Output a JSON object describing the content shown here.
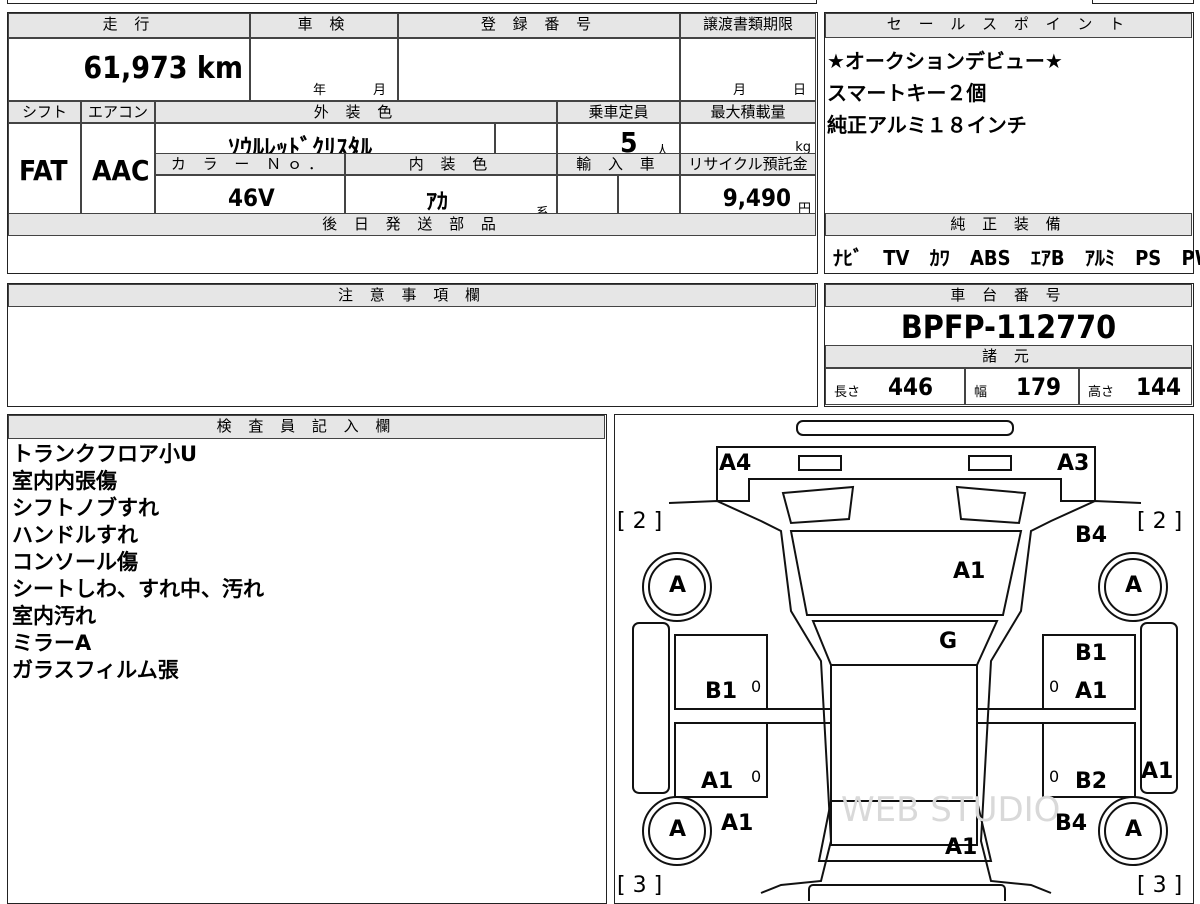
{
  "top": {
    "mileage_label": "走 行",
    "mileage": "61,973 km",
    "inspection_label": "車 検",
    "year_unit": "年",
    "month_unit": "月",
    "reg_label": "登 録 番 号",
    "transfer_label": "譲渡書類期限",
    "transfer_month": "月",
    "transfer_day": "日",
    "shift_label": "シフト",
    "shift": "FAT",
    "ac_label": "エアコン",
    "ac": "AAC",
    "exterior_label": "外 装 色",
    "exterior": "ｿｳﾙﾚｯﾄﾞｸﾘｽﾀﾙ",
    "capacity_label": "乗車定員",
    "capacity": "5",
    "capacity_unit": "人",
    "maxload_label": "最大積載量",
    "maxload_unit": "kg",
    "colorno_label": "カ ラ ー Ｎｏ．",
    "colorno": "46V",
    "interior_label": "内 装 色",
    "interior": "ｱｶ",
    "interior_suffix": "系",
    "import_label": "輸 入 車",
    "recycle_label": "リサイクル預託金",
    "recycle": "9,490",
    "recycle_unit": "円",
    "later_parts_label": "後 日 発 送 部 品"
  },
  "sales": {
    "label": "セ ー ル ス ポ イ ン ト",
    "lines": [
      "★オークションデビュー★",
      "スマートキー２個",
      "純正アルミ１８インチ"
    ]
  },
  "equipment": {
    "label": "純 正 装 備",
    "items": [
      "ﾅﾋﾞ",
      "TV",
      "ｶﾜ",
      "ABS",
      "ｴｱB",
      "ｱﾙﾐ",
      "PS",
      "PW"
    ]
  },
  "notes": {
    "label": "注 意 事 項 欄"
  },
  "chassis": {
    "label": "車 台 番 号",
    "number": "BPFP-112770"
  },
  "specs": {
    "label": "諸 元",
    "length_label": "長さ",
    "length": "446",
    "width_label": "幅",
    "width": "179",
    "height_label": "高さ",
    "height": "144"
  },
  "inspector": {
    "label": "検 査 員 記 入 欄",
    "lines": [
      "トランクフロア小U",
      "室内内張傷",
      "シフトノブすれ",
      "ハンドルすれ",
      "コンソール傷",
      "シートしわ、すれ中、汚れ",
      "室内汚れ",
      "ミラーA",
      "ガラスフィルム張"
    ]
  },
  "diagram": {
    "a4": "A4",
    "a3": "A3",
    "b4_top": "B4",
    "a1_roof": "A1",
    "g": "G",
    "b1_left": "B1",
    "b1_right": "B1",
    "a1_right_door": "A1",
    "a1_left_rear": "A1",
    "b2": "B2",
    "a1_right_side": "A1",
    "a1_left_low": "A1",
    "b4_bottom": "B4",
    "a1_bottom": "A1",
    "wheel": "A",
    "bracket2": "[ 2 ]",
    "bracket3": "[ 3 ]",
    "zero": "0",
    "watermark": "WEB STUDIO"
  }
}
